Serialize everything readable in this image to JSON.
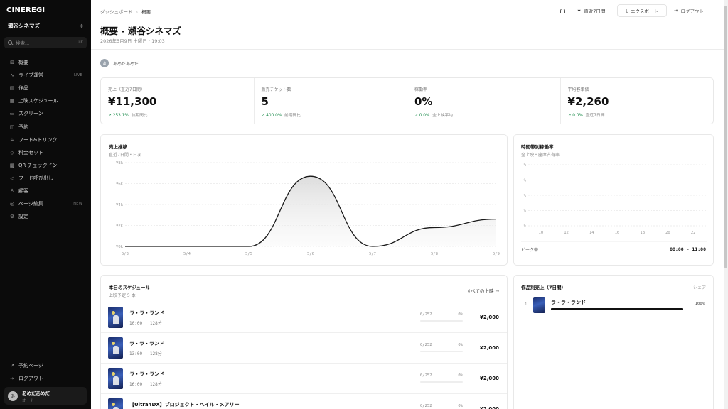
{
  "brand": "CINEREGI",
  "sidebar": {
    "theater": "瀬谷シネマズ",
    "search_placeholder": "検索...",
    "search_kbd": "⌘K",
    "items": [
      {
        "icon": "⊞",
        "label": "概要",
        "badge": ""
      },
      {
        "icon": "∿",
        "label": "ライブ運営",
        "badge": "LIVE"
      },
      {
        "icon": "▤",
        "label": "作品",
        "badge": ""
      },
      {
        "icon": "▦",
        "label": "上映スケジュール",
        "badge": ""
      },
      {
        "icon": "▭",
        "label": "スクリーン",
        "badge": ""
      },
      {
        "icon": "◫",
        "label": "予約",
        "badge": ""
      },
      {
        "icon": "☕",
        "label": "フード&ドリンク",
        "badge": ""
      },
      {
        "icon": "◇",
        "label": "料金セット",
        "badge": ""
      },
      {
        "icon": "▩",
        "label": "QR チェックイン",
        "badge": ""
      },
      {
        "icon": "◁",
        "label": "フード呼び出し",
        "badge": ""
      },
      {
        "icon": "♙",
        "label": "顧客",
        "badge": ""
      },
      {
        "icon": "◎",
        "label": "ページ編集",
        "badge": "NEW"
      },
      {
        "icon": "⚙",
        "label": "設定",
        "badge": ""
      }
    ],
    "footer": [
      {
        "icon": "↗",
        "label": "予約ページ"
      },
      {
        "icon": "⇥",
        "label": "ログアウト"
      }
    ],
    "user": {
      "initial": "あ",
      "name": "あめだあめだ",
      "role": "オーナー"
    }
  },
  "header": {
    "breadcrumb": [
      "ダッシュボード",
      "概要"
    ],
    "title": "概要 - 瀬谷シネマズ",
    "subtitle": "2026年5月9日 土曜日 · 19:03",
    "range": "直近7日間",
    "export": "エクスポート",
    "logout": "ログアウト"
  },
  "tag": {
    "initial": "あ",
    "label": "あめだあめだ"
  },
  "kpis": [
    {
      "label": "売上（直近7日間）",
      "value": "¥11,300",
      "delta": "↗ 253.1%",
      "note": "前期間比"
    },
    {
      "label": "販売チケット数",
      "value": "5",
      "delta": "↗ 400.0%",
      "note": "前期間比"
    },
    {
      "label": "稼働率",
      "value": "0%",
      "delta": "↗ 0.0%",
      "note": "全上映平均"
    },
    {
      "label": "平均客単価",
      "value": "¥2,260",
      "delta": "↗ 0.0%",
      "note": "直近7日間"
    }
  ],
  "sales_chart": {
    "title": "売上推移",
    "subtitle": "直近7日間・日次",
    "chart_data": {
      "type": "area",
      "x": [
        "5/3",
        "5/4",
        "5/5",
        "5/6",
        "5/7",
        "5/8",
        "5/9"
      ],
      "values": [
        0,
        0,
        0,
        6700,
        0,
        1800,
        2600
      ],
      "yticks": [
        "¥0k",
        "¥2k",
        "¥4k",
        "¥6k",
        "¥8k"
      ],
      "ylim": [
        0,
        8000
      ],
      "grid": true
    }
  },
  "occupancy_chart": {
    "title": "時間帯別稼働率",
    "subtitle": "全上映・座席占有率",
    "chart_data": {
      "type": "bar",
      "categories": [
        "10",
        "12",
        "14",
        "16",
        "18",
        "20",
        "22"
      ],
      "values": [
        0,
        0,
        0,
        0,
        0,
        0,
        0
      ],
      "yticks": [
        "%",
        "%",
        "%",
        "%",
        "%"
      ],
      "grid": true
    },
    "peak_label": "ピーク帯",
    "peak_value": "08:00 - 11:00"
  },
  "schedule": {
    "title": "本日のスケジュール",
    "subtitle": "上映予定 5 本",
    "link": "すべての上映 →",
    "rows": [
      {
        "title": "ラ・ラ・ランド",
        "time": "10:00 · 128分",
        "seats": "0/252",
        "pct": "0%",
        "price": "¥2,000"
      },
      {
        "title": "ラ・ラ・ランド",
        "time": "13:00 · 128分",
        "seats": "0/252",
        "pct": "0%",
        "price": "¥2,000"
      },
      {
        "title": "ラ・ラ・ランド",
        "time": "16:00 · 128分",
        "seats": "0/252",
        "pct": "0%",
        "price": "¥2,000"
      },
      {
        "title": "【Ultra4DX】プロジェクト・ヘイル・メアリー",
        "time": "",
        "seats": "0/252",
        "pct": "0%",
        "price": "¥2,000"
      }
    ]
  },
  "works": {
    "title": "作品別売上（7日間）",
    "share_label": "シェア",
    "items": [
      {
        "rank": "1",
        "title": "ラ・ラ・ランド",
        "share": "100%",
        "fraction": 1.0
      }
    ]
  }
}
